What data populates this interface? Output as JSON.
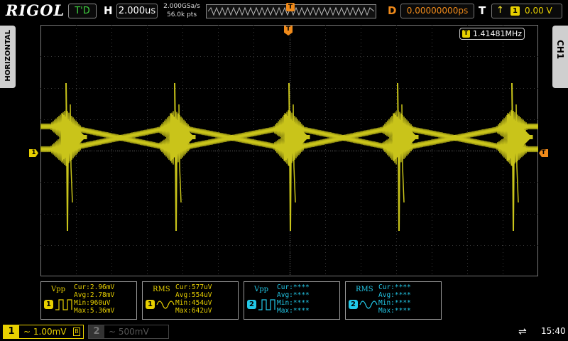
{
  "topbar": {
    "logo": "RIGOL",
    "run_status": "T'D",
    "horizontal_label": "H",
    "timebase": "2.000us",
    "sample_rate": "2.000GSa/s",
    "memory_depth": "56.0k pts",
    "memory_trigger_marker": "T",
    "delay_label": "D",
    "delay_value": "0.00000000ps",
    "trigger_label": "T",
    "trigger_edge_icon": "rising-edge-icon",
    "trigger_source": "1",
    "trigger_level": "0.00 V"
  },
  "side_tabs": {
    "left": "HORIZONTAL",
    "right": "CH1"
  },
  "plot": {
    "freq_badge": "T",
    "frequency": "1.41481MHz",
    "ch1_marker": "1",
    "trigger_marker": "T",
    "trace_color": "#c9c41a",
    "grid_color": "#3a3a3a"
  },
  "measurements": [
    {
      "name": "Vpp",
      "channel": "1",
      "cur": "Cur:2.96mV",
      "avg": "Avg:2.78mV",
      "min": "Min:960uV",
      "max": "Max:5.36mV"
    },
    {
      "name": "RMS",
      "channel": "1",
      "cur": "Cur:577uV",
      "avg": "Avg:554uV",
      "min": "Min:454uV",
      "max": "Max:642uV"
    },
    {
      "name": "Vpp",
      "channel": "2",
      "cur": "Cur:****",
      "avg": "Avg:****",
      "min": "Min:****",
      "max": "Max:****"
    },
    {
      "name": "RMS",
      "channel": "2",
      "cur": "Cur:****",
      "avg": "Avg:****",
      "min": "Min:****",
      "max": "Max:****"
    }
  ],
  "bottombar": {
    "ch1_num": "1",
    "ch1_scale": "~ 1.00mV",
    "ch1_bw_limit": "B",
    "ch2_num": "2",
    "ch2_scale": "~  500mV",
    "usb_icon": "usb-icon",
    "usb_glyph": "⇌",
    "time": "15:40"
  }
}
